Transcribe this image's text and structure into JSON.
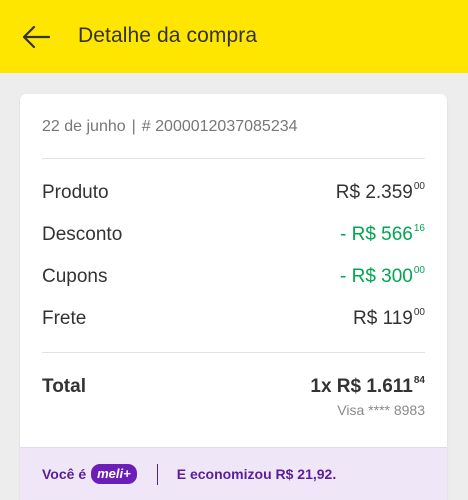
{
  "header": {
    "title": "Detalhe da compra",
    "back_icon": "arrow-left-icon",
    "background": "#ffe600"
  },
  "order": {
    "date": "22 de junho",
    "separator": "|",
    "number": "# 2000012037085234"
  },
  "summary": {
    "rows": [
      {
        "label": "Produto",
        "value_main": "R$ 2.359",
        "value_cents": "00",
        "color": "#333333"
      },
      {
        "label": "Desconto",
        "value_main": "- R$ 566",
        "value_cents": "16",
        "color": "#00a650"
      },
      {
        "label": "Cupons",
        "value_main": "- R$ 300",
        "value_cents": "00",
        "color": "#00a650"
      },
      {
        "label": "Frete",
        "value_main": "R$ 119",
        "value_cents": "00",
        "color": "#333333"
      }
    ],
    "total": {
      "label": "Total",
      "value_main": "1x R$ 1.611",
      "value_cents": "84"
    },
    "payment": "Visa **** 8983"
  },
  "footer": {
    "prefix": "Você é",
    "badge": "meli+",
    "savings": "E economizou R$ 21,92.",
    "accent": "#6b1fb8"
  }
}
